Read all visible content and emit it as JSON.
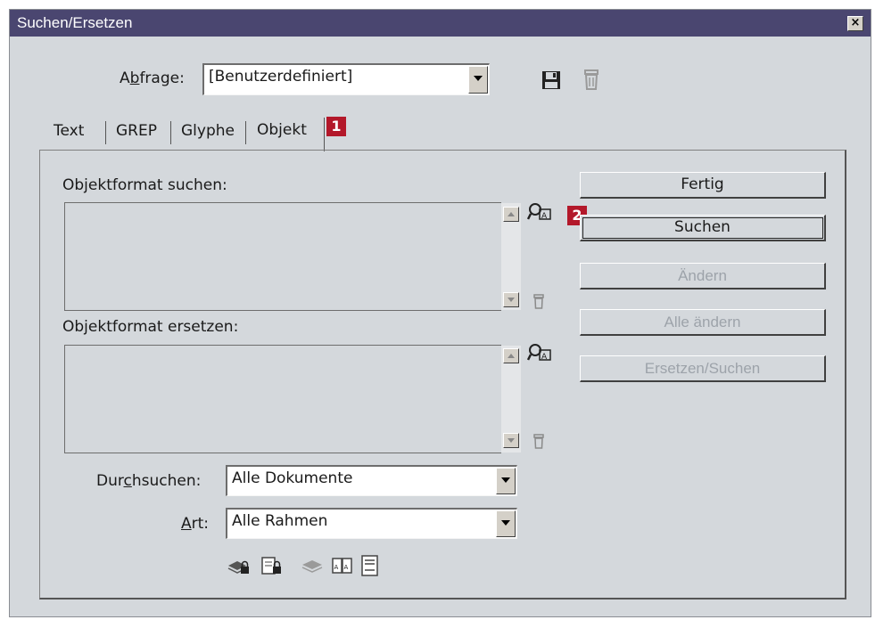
{
  "window": {
    "title": "Suchen/Ersetzen",
    "close_label": "×"
  },
  "query": {
    "label_pre": "A",
    "label_key": "b",
    "label_post": "frage:",
    "value": "[Benutzerdefiniert]"
  },
  "tabs": [
    {
      "label": "Text"
    },
    {
      "label": "GREP"
    },
    {
      "label": "Glyphe"
    },
    {
      "label": "Objekt"
    }
  ],
  "search_format": {
    "label": "Objektformat suchen:"
  },
  "replace_format": {
    "label": "Objektformat ersetzen:"
  },
  "scope": {
    "label_pre": "Dur",
    "label_key": "c",
    "label_post": "hsuchen:",
    "value": "Alle Dokumente"
  },
  "type": {
    "label_key": "A",
    "label_post": "rt:",
    "value": "Alle Rahmen"
  },
  "buttons": {
    "done": "Fertig",
    "search": "Suchen",
    "change": "Ändern",
    "change_all": "Alle ändern",
    "change_find": "Ersetzen/Suchen"
  },
  "markers": {
    "one": "1",
    "two": "2"
  },
  "icons": {
    "save": "save-query-icon",
    "delete": "delete-query-icon",
    "specify_format": "specify-format-icon",
    "clear_format": "clear-format-icon",
    "options": [
      "locked-layers-icon",
      "locked-items-icon",
      "hidden-layers-icon",
      "master-pages-icon",
      "footnotes-icon"
    ]
  }
}
